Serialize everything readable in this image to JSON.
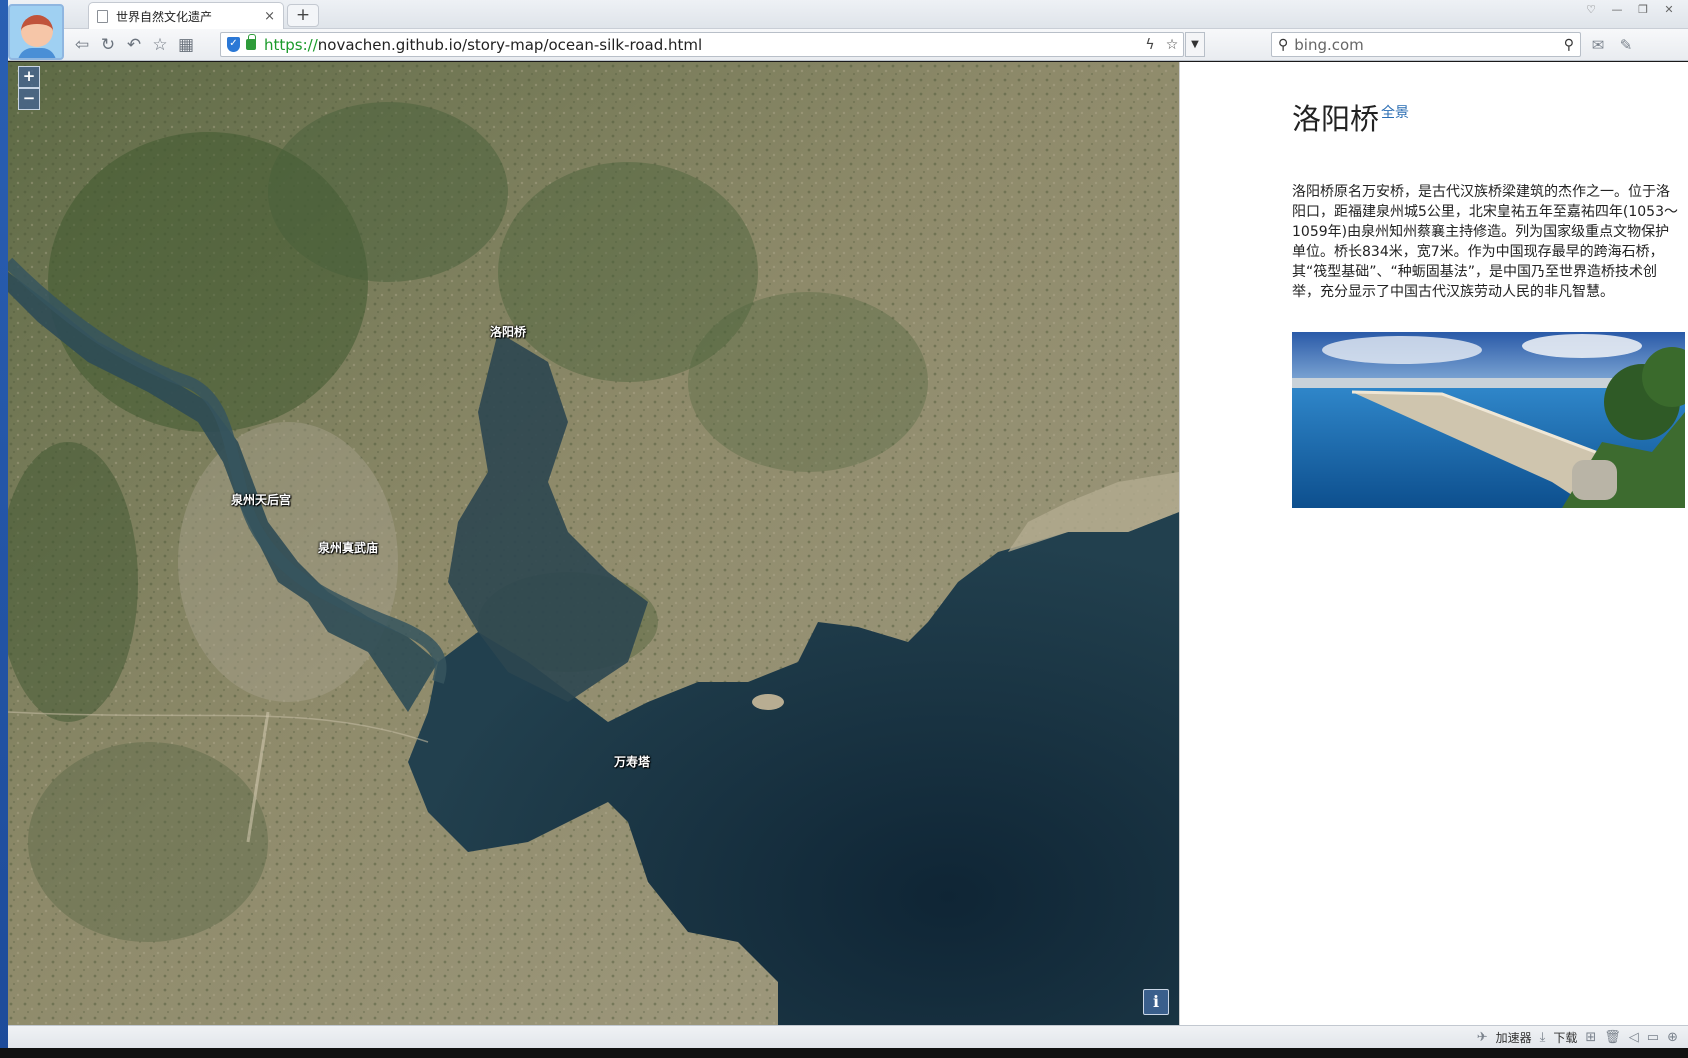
{
  "browser": {
    "tab_title": "世界自然文化遗产",
    "tab_close": "×",
    "new_tab": "+",
    "url_protocol": "https://",
    "url_rest": "novachen.github.io/story-map/ocean-silk-road.html",
    "search_text": "bing.com"
  },
  "map": {
    "zoom_in": "+",
    "zoom_out": "−",
    "info": "i",
    "labels": {
      "luoyang_bridge": "洛阳桥",
      "tianhou_temple": "泉州天后宫",
      "zhenwu_temple": "泉州真武庙",
      "wanshou_pagoda": "万寿塔"
    }
  },
  "panel": {
    "title": "洛阳桥",
    "full_view_link": "全景",
    "description": "洛阳桥原名万安桥，是古代汉族桥梁建筑的杰作之一。位于洛阳口，距福建泉州城5公里，北宋皇祐五年至嘉祐四年(1053～1059年)由泉州知州蔡襄主持修造。列为国家级重点文物保护单位。桥长834米，宽7米。作为中国现存最早的跨海石桥，其“筏型基础”、“种蛎固基法”，是中国乃至世界造桥技术创举，充分显示了中国古代汉族劳动人民的非凡智慧。"
  },
  "statusbar": {
    "accelerator": "加速器",
    "download": "下载"
  },
  "colors": {
    "link": "#2a6db3",
    "sea": "#1c3445",
    "land": "#8a8766"
  }
}
